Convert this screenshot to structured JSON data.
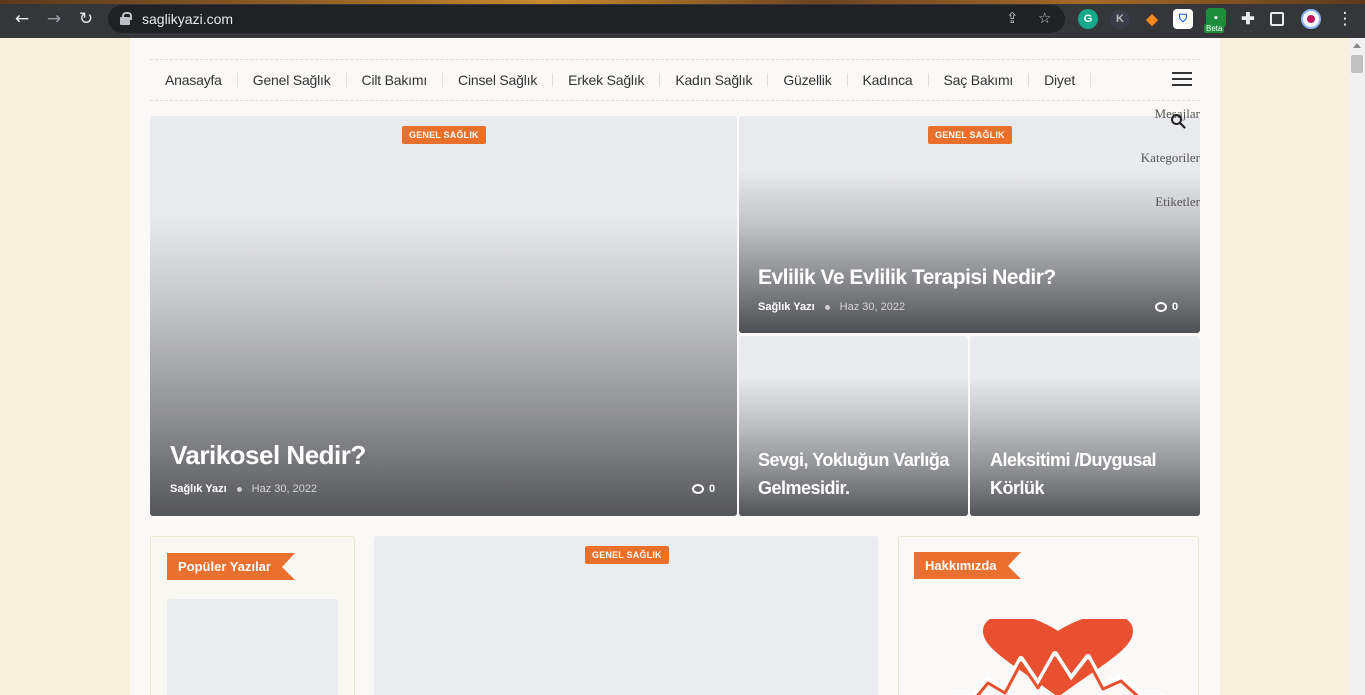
{
  "browser": {
    "url": "saglikyazi.com",
    "extensions": [
      "grammarly-icon",
      "k-extension-icon",
      "metamask-icon",
      "bitwarden-icon",
      "beta-extension-icon"
    ],
    "beta_label": "Beta"
  },
  "menu": {
    "items": [
      {
        "label": "Anasayfa"
      },
      {
        "label": "Genel Sağlık"
      },
      {
        "label": "Cilt Bakımı"
      },
      {
        "label": "Cinsel Sağlık"
      },
      {
        "label": "Erkek Sağlık"
      },
      {
        "label": "Kadın Sağlık"
      },
      {
        "label": "Güzellik"
      },
      {
        "label": "Kadınca"
      },
      {
        "label": "Saç Bakımı"
      },
      {
        "label": "Diyet"
      }
    ]
  },
  "side_links": [
    "Mesajlar",
    "Kategoriler",
    "Etiketler"
  ],
  "featured": {
    "main": {
      "category": "GENEL SAĞLIK",
      "title": "Varikosel Nedir?",
      "author": "Sağlık Yazı",
      "date": "Haz 30, 2022",
      "comments": "0"
    },
    "top_right": {
      "category": "GENEL SAĞLIK",
      "title": "Evlilik Ve Evlilik Terapisi Nedir?",
      "author": "Sağlık Yazı",
      "date": "Haz 30, 2022",
      "comments": "0"
    },
    "small_1": {
      "title": "Sevgi, Yokluğun Varlığa Gelmesidir."
    },
    "small_2": {
      "title": "Aleksitimi /Duygusal Körlük"
    }
  },
  "popular": {
    "title": "Popüler Yazılar"
  },
  "center_post": {
    "category": "GENEL SAĞLIK"
  },
  "about": {
    "title": "Hakkımızda"
  },
  "colors": {
    "accent": "#e8702a",
    "background": "#f7f0dc",
    "heart": "#e8502f"
  }
}
